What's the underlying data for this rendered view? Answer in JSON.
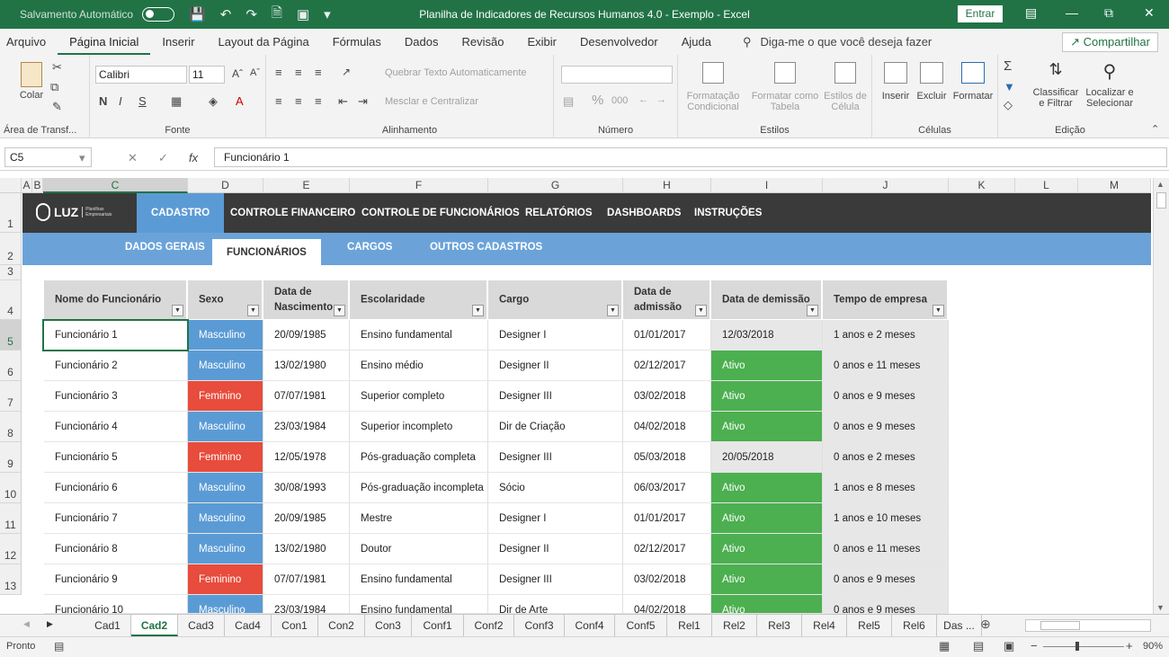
{
  "titlebar": {
    "autosave": "Salvamento Automático",
    "title": "Planilha de Indicadores de Recursos Humanos 4.0 - Exemplo  -  Excel",
    "signin": "Entrar"
  },
  "ribbon_tabs": [
    {
      "label": "Arquivo"
    },
    {
      "label": "Página Inicial"
    },
    {
      "label": "Inserir"
    },
    {
      "label": "Layout da Página"
    },
    {
      "label": "Fórmulas"
    },
    {
      "label": "Dados"
    },
    {
      "label": "Revisão"
    },
    {
      "label": "Exibir"
    },
    {
      "label": "Desenvolvedor"
    },
    {
      "label": "Ajuda"
    }
  ],
  "tellme": "Diga-me o que você deseja fazer",
  "share": "Compartilhar",
  "ribbon": {
    "clipboard": {
      "paste": "Colar",
      "label": "Área de Transf..."
    },
    "font": {
      "name": "Calibri",
      "size": "11",
      "label": "Fonte",
      "bold": "N",
      "italic": "I",
      "underline": "S"
    },
    "alignment": {
      "wrap": "Quebrar Texto Automaticamente",
      "merge": "Mesclar e Centralizar",
      "label": "Alinhamento"
    },
    "number": {
      "label": "Número",
      "percent": "%",
      "thousands": "000"
    },
    "styles": {
      "conditional1": "Formatação",
      "conditional2": "Condicional",
      "table1": "Formatar como",
      "table2": "Tabela",
      "cell1": "Estilos de",
      "cell2": "Célula",
      "label": "Estilos"
    },
    "cells": {
      "insert": "Inserir",
      "delete": "Excluir",
      "format": "Formatar",
      "label": "Células"
    },
    "editing": {
      "sort1": "Classificar",
      "sort2": "e Filtrar",
      "find1": "Localizar e",
      "find2": "Selecionar",
      "label": "Edição"
    }
  },
  "namebox": "C5",
  "formula": "Funcionário 1",
  "columns": [
    "A",
    "B",
    "C",
    "D",
    "E",
    "F",
    "G",
    "H",
    "I",
    "J",
    "K",
    "L",
    "M"
  ],
  "rows": [
    "1",
    "2",
    "3",
    "4",
    "5",
    "6",
    "7",
    "8",
    "9",
    "10",
    "11",
    "12",
    "13"
  ],
  "nav": {
    "logo": "LUZ",
    "logo_sub1": "Planilhas",
    "logo_sub2": "Empresariais",
    "items": [
      "CADASTRO",
      "CONTROLE FINANCEIRO",
      "CONTROLE DE FUNCIONÁRIOS",
      "RELATÓRIOS",
      "DASHBOARDS",
      "INSTRUÇÕES"
    ]
  },
  "subnav": [
    "DADOS GERAIS",
    "FUNCIONÁRIOS",
    "CARGOS",
    "OUTROS CADASTROS"
  ],
  "table": {
    "headers": [
      "Nome do Funcionário",
      "Sexo",
      "Data de Nascimento",
      "Escolaridade",
      "Cargo",
      "Data de admissão",
      "Data de demissão",
      "Tempo de empresa"
    ],
    "rows": [
      [
        "Funcionário 1",
        "Masculino",
        "20/09/1985",
        "Ensino fundamental",
        "Designer I",
        "01/01/2017",
        "12/03/2018",
        "1 anos e 2 meses"
      ],
      [
        "Funcionário 2",
        "Masculino",
        "13/02/1980",
        "Ensino médio",
        "Designer II",
        "02/12/2017",
        "Ativo",
        "0 anos e 11 meses"
      ],
      [
        "Funcionário 3",
        "Feminino",
        "07/07/1981",
        "Superior completo",
        "Designer III",
        "03/02/2018",
        "Ativo",
        "0 anos e 9 meses"
      ],
      [
        "Funcionário 4",
        "Masculino",
        "23/03/1984",
        "Superior incompleto",
        "Dir de Criação",
        "04/02/2018",
        "Ativo",
        "0 anos e 9 meses"
      ],
      [
        "Funcionário 5",
        "Feminino",
        "12/05/1978",
        "Pós-graduação completa",
        "Designer III",
        "05/03/2018",
        "20/05/2018",
        "0 anos e 2 meses"
      ],
      [
        "Funcionário 6",
        "Masculino",
        "30/08/1993",
        "Pós-graduação incompleta",
        "Sócio",
        "06/03/2017",
        "Ativo",
        "1 anos e 8 meses"
      ],
      [
        "Funcionário 7",
        "Masculino",
        "20/09/1985",
        "Mestre",
        "Designer I",
        "01/01/2017",
        "Ativo",
        "1 anos e 10 meses"
      ],
      [
        "Funcionário 8",
        "Masculino",
        "13/02/1980",
        "Doutor",
        "Designer II",
        "02/12/2017",
        "Ativo",
        "0 anos e 11 meses"
      ],
      [
        "Funcionário 9",
        "Feminino",
        "07/07/1981",
        "Ensino fundamental",
        "Designer III",
        "03/02/2018",
        "Ativo",
        "0 anos e 9 meses"
      ],
      [
        "Funcionário 10",
        "Masculino",
        "23/03/1984",
        "Ensino fundamental",
        "Dir de Arte",
        "04/02/2018",
        "Ativo",
        "0 anos e 9 meses"
      ]
    ]
  },
  "sheet_tabs": [
    "Cad1",
    "Cad2",
    "Cad3",
    "Cad4",
    "Con1",
    "Con2",
    "Con3",
    "Conf1",
    "Conf2",
    "Conf3",
    "Conf4",
    "Conf5",
    "Rel1",
    "Rel2",
    "Rel3",
    "Rel4",
    "Rel5",
    "Rel6",
    "Das ..."
  ],
  "status": {
    "ready": "Pronto",
    "zoom": "90%"
  },
  "colors": {
    "excel_green": "#217346",
    "male": "#5b9bd5",
    "female": "#e74c3c",
    "active": "#4caf50"
  }
}
